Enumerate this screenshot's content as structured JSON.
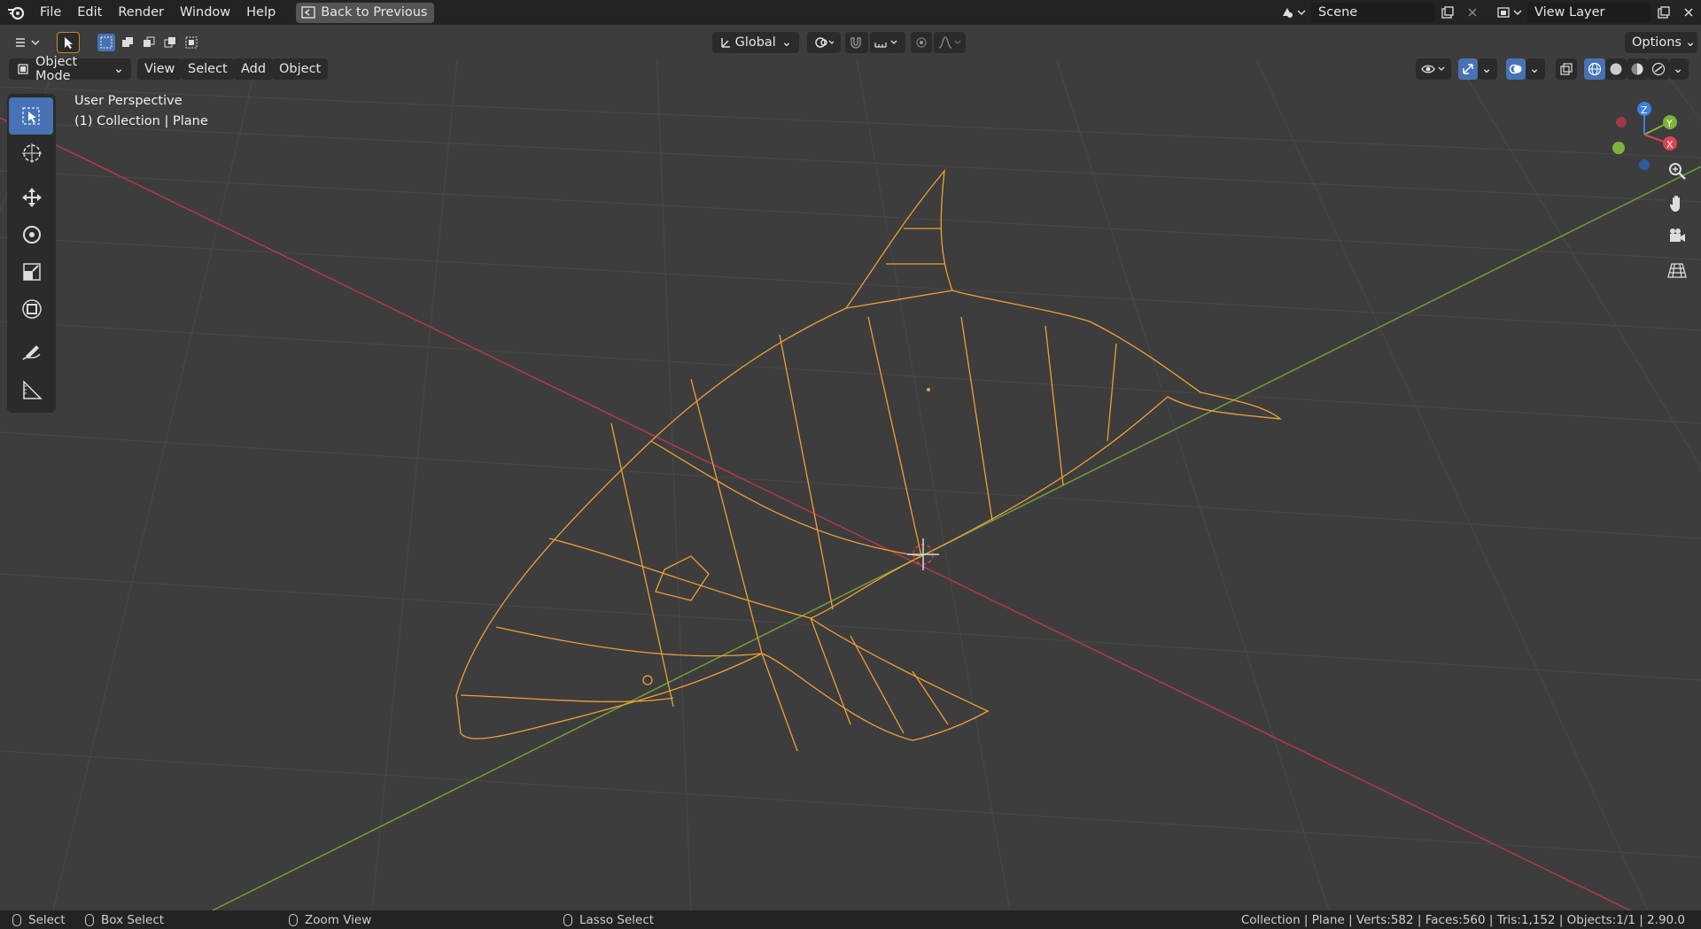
{
  "topbar": {
    "menus": [
      "File",
      "Edit",
      "Render",
      "Window",
      "Help"
    ],
    "back_label": "Back to Previous",
    "scene": "Scene",
    "view_layer": "View Layer"
  },
  "toolbar": {
    "transform_orientation": "Global",
    "options_label": "Options"
  },
  "header": {
    "mode": "Object Mode",
    "menus": [
      "View",
      "Select",
      "Add",
      "Object"
    ]
  },
  "viewport": {
    "perspective": "User Perspective",
    "collection": "(1) Collection | Plane",
    "gizmo": {
      "z": "Z",
      "y": "Y",
      "x": "X"
    }
  },
  "tools": [
    "select-box",
    "cursor",
    "move",
    "rotate",
    "scale",
    "transform",
    "annotate",
    "measure"
  ],
  "status": {
    "select": "Select",
    "box_select": "Box Select",
    "zoom_view": "Zoom View",
    "lasso_select": "Lasso Select",
    "stats": "Collection | Plane | Verts:582 | Faces:560 | Tris:1,152 | Objects:1/1 | 2.90.0"
  },
  "colors": {
    "wire": "#f0a035",
    "x_axis": "#b63a4a",
    "y_axis": "#6e9a32",
    "active": "#4772b3"
  }
}
